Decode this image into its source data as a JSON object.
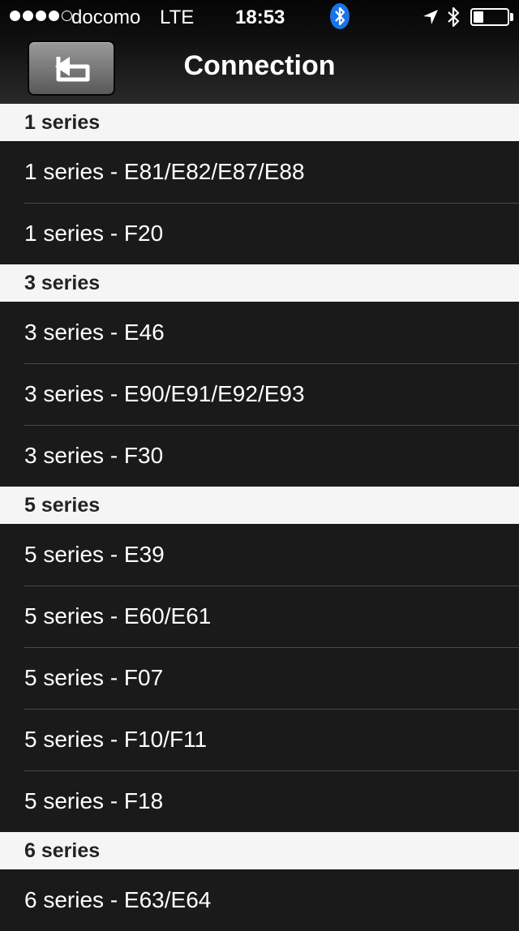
{
  "status_bar": {
    "signal_dots_filled": 4,
    "signal_dots_total": 5,
    "carrier": "docomo",
    "network": "LTE",
    "time": "18:53",
    "battery_level": 0.3,
    "bluetooth_color": "#1a73e8"
  },
  "nav": {
    "title": "Connection",
    "back_icon": "back-arrow-icon"
  },
  "sections": [
    {
      "header": "1 series",
      "items": [
        "1 series - E81/E82/E87/E88",
        "1 series - F20"
      ]
    },
    {
      "header": "3 series",
      "items": [
        "3 series - E46",
        "3 series - E90/E91/E92/E93",
        "3 series - F30"
      ]
    },
    {
      "header": "5 series",
      "items": [
        "5 series - E39",
        "5 series - E60/E61",
        "5 series - F07",
        "5 series - F10/F11",
        "5 series - F18"
      ]
    },
    {
      "header": "6 series",
      "items": [
        "6 series - E63/E64"
      ]
    }
  ]
}
